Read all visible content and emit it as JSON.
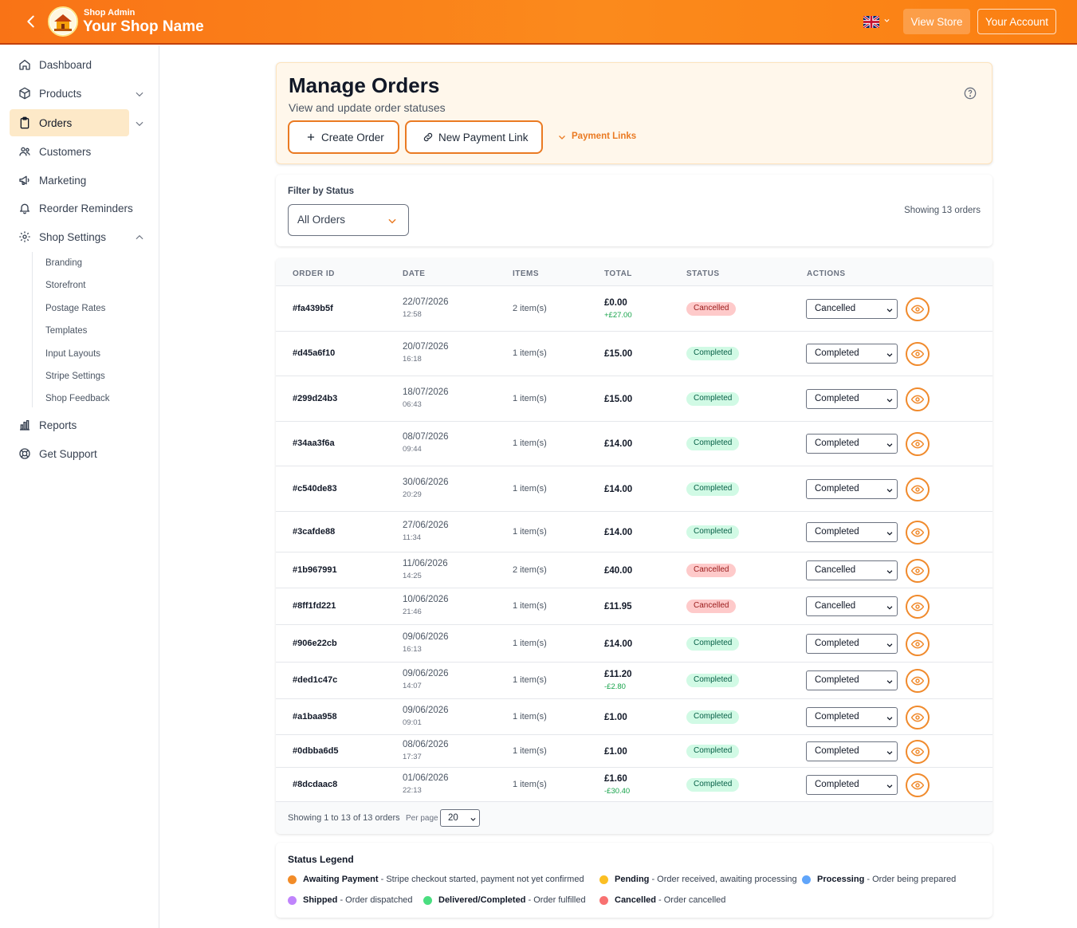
{
  "header": {
    "subtitle": "Shop Admin",
    "shop_name": "Your Shop Name",
    "view_store": "View Store",
    "your_account": "Your Account"
  },
  "sidebar": {
    "items": [
      {
        "label": "Dashboard",
        "icon": "home-icon"
      },
      {
        "label": "Products",
        "icon": "box-icon"
      },
      {
        "label": "Orders",
        "icon": "clipboard-icon"
      },
      {
        "label": "Customers",
        "icon": "users-icon"
      },
      {
        "label": "Marketing",
        "icon": "megaphone-icon"
      },
      {
        "label": "Reorder Reminders",
        "icon": "bell-icon"
      },
      {
        "label": "Shop Settings",
        "icon": "gear-icon"
      },
      {
        "label": "Reports",
        "icon": "bar-chart-icon"
      },
      {
        "label": "Get Support",
        "icon": "lifebuoy-icon"
      }
    ],
    "settings_sub": [
      "Branding",
      "Storefront",
      "Postage Rates",
      "Templates",
      "Input Layouts",
      "Stripe Settings",
      "Shop Feedback"
    ]
  },
  "hero": {
    "title": "Manage Orders",
    "subtitle": "View and update order statuses",
    "create_order": "Create Order",
    "new_payment_link": "New Payment Link",
    "payment_links": "Payment Links"
  },
  "filter": {
    "label": "Filter by Status",
    "selected": "All Orders",
    "showing": "Showing 13 orders"
  },
  "table": {
    "columns": [
      "ORDER ID",
      "DATE",
      "ITEMS",
      "TOTAL",
      "STATUS",
      "ACTIONS"
    ],
    "rows": [
      {
        "id": "#fa439b5f",
        "date": "22/07/2026",
        "time": "12:58",
        "items": "2 item(s)",
        "total": "£0.00",
        "adj": "+£27.00",
        "status": "Cancelled",
        "action": "Cancelled"
      },
      {
        "id": "#d45a6f10",
        "date": "20/07/2026",
        "time": "16:18",
        "items": "1 item(s)",
        "total": "£15.00",
        "adj": "",
        "status": "Completed",
        "action": "Completed"
      },
      {
        "id": "#299d24b3",
        "date": "18/07/2026",
        "time": "06:43",
        "items": "1 item(s)",
        "total": "£15.00",
        "adj": "",
        "status": "Completed",
        "action": "Completed"
      },
      {
        "id": "#34aa3f6a",
        "date": "08/07/2026",
        "time": "09:44",
        "items": "1 item(s)",
        "total": "£14.00",
        "adj": "",
        "status": "Completed",
        "action": "Completed"
      },
      {
        "id": "#c540de83",
        "date": "30/06/2026",
        "time": "20:29",
        "items": "1 item(s)",
        "total": "£14.00",
        "adj": "",
        "status": "Completed",
        "action": "Completed"
      },
      {
        "id": "#3cafde88",
        "date": "27/06/2026",
        "time": "11:34",
        "items": "1 item(s)",
        "total": "£14.00",
        "adj": "",
        "status": "Completed",
        "action": "Completed"
      },
      {
        "id": "#1b967991",
        "date": "11/06/2026",
        "time": "14:25",
        "items": "2 item(s)",
        "total": "£40.00",
        "adj": "",
        "status": "Cancelled",
        "action": "Cancelled"
      },
      {
        "id": "#8ff1fd221",
        "date": "10/06/2026",
        "time": "21:46",
        "items": "1 item(s)",
        "total": "£11.95",
        "adj": "",
        "status": "Cancelled",
        "action": "Cancelled"
      },
      {
        "id": "#906e22cb",
        "date": "09/06/2026",
        "time": "16:13",
        "items": "1 item(s)",
        "total": "£14.00",
        "adj": "",
        "status": "Completed",
        "action": "Completed"
      },
      {
        "id": "#ded1c47c",
        "date": "09/06/2026",
        "time": "14:07",
        "items": "1 item(s)",
        "total": "£11.20",
        "adj": "-£2.80",
        "status": "Completed",
        "action": "Completed"
      },
      {
        "id": "#a1baa958",
        "date": "09/06/2026",
        "time": "09:01",
        "items": "1 item(s)",
        "total": "£1.00",
        "adj": "",
        "status": "Completed",
        "action": "Completed"
      },
      {
        "id": "#0dbba6d5",
        "date": "08/06/2026",
        "time": "17:37",
        "items": "1 item(s)",
        "total": "£1.00",
        "adj": "",
        "status": "Completed",
        "action": "Completed"
      },
      {
        "id": "#8dcdaac8",
        "date": "01/06/2026",
        "time": "22:13",
        "items": "1 item(s)",
        "total": "£1.60",
        "adj": "-£30.40",
        "status": "Completed",
        "action": "Completed"
      }
    ],
    "footer_text": "Showing 1 to 13 of 13 orders",
    "per_page_label": "Per page",
    "per_page_value": "20"
  },
  "legend": {
    "title": "Status Legend",
    "entries": [
      {
        "name": "Awaiting Payment",
        "desc": " - Stripe checkout started, payment not yet confirmed",
        "color": "#f28c28"
      },
      {
        "name": "Pending",
        "desc": " - Order received, awaiting processing",
        "color": "#fbbf24"
      },
      {
        "name": "Processing",
        "desc": " - Order being prepared",
        "color": "#60a5fa"
      },
      {
        "name": "Shipped",
        "desc": " - Order dispatched",
        "color": "#c084fc"
      },
      {
        "name": "Delivered/Completed",
        "desc": " - Order fulfilled",
        "color": "#4ade80"
      },
      {
        "name": "Cancelled",
        "desc": " - Order cancelled",
        "color": "#f87171"
      }
    ]
  },
  "colors": {
    "accent": "#f97316",
    "completed_bg": "#d1fae5",
    "cancelled_bg": "#fecaca"
  }
}
